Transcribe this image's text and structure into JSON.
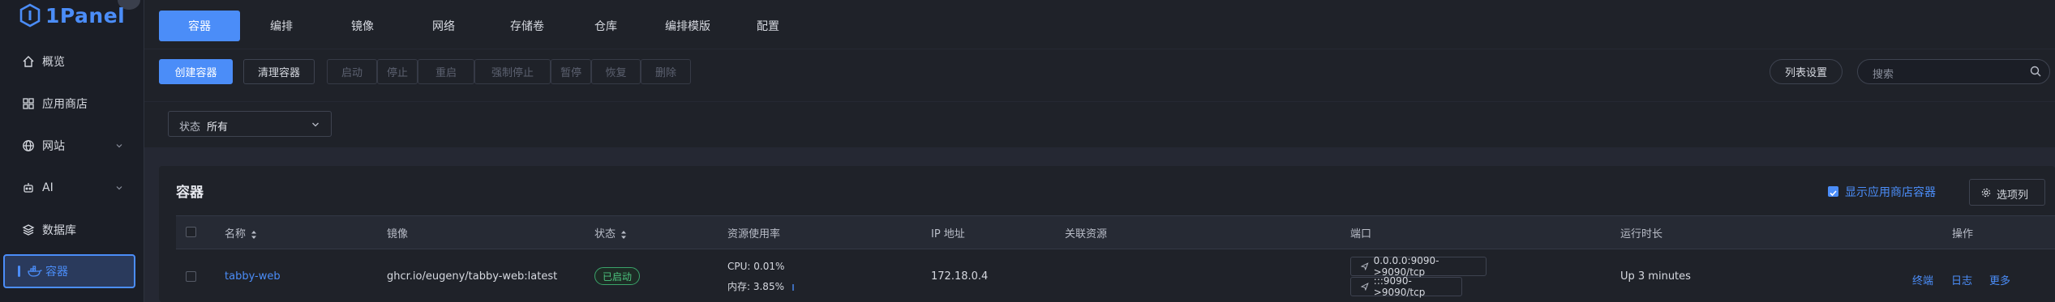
{
  "app": {
    "logo_text": "1Panel"
  },
  "sidebar": {
    "items": [
      {
        "label": "概览",
        "icon": "home-icon"
      },
      {
        "label": "应用商店",
        "icon": "grid-icon"
      },
      {
        "label": "网站",
        "icon": "globe-icon"
      },
      {
        "label": "AI",
        "icon": "robot-icon"
      },
      {
        "label": "数据库",
        "icon": "layers-icon"
      },
      {
        "label": "容器",
        "icon": "docker-icon"
      }
    ]
  },
  "tabs": [
    "容器",
    "编排",
    "镜像",
    "网络",
    "存储卷",
    "仓库",
    "编排模版",
    "配置"
  ],
  "toolbar": {
    "create_label": "创建容器",
    "clean_label": "清理容器",
    "actions": [
      "启动",
      "停止",
      "重启",
      "强制停止",
      "暂停",
      "恢复",
      "删除"
    ],
    "list_settings_label": "列表设置",
    "search_placeholder": "搜索"
  },
  "filter": {
    "status_label": "状态",
    "status_value": "所有"
  },
  "panel": {
    "title": "容器",
    "show_app_store_label": "显示应用商店容器",
    "columns_label": "选项列"
  },
  "table": {
    "headers": {
      "name": "名称",
      "image": "镜像",
      "status": "状态",
      "resources": "资源使用率",
      "ip": "IP 地址",
      "related": "关联资源",
      "ports": "端口",
      "uptime": "运行时长",
      "actions": "操作"
    },
    "rows": [
      {
        "name": "tabby-web",
        "image": "ghcr.io/eugeny/tabby-web:latest",
        "status": "已启动",
        "cpu": "CPU: 0.01%",
        "mem": "内存: 3.85%",
        "ip": "172.18.0.4",
        "ports": [
          "0.0.0.0:9090->9090/tcp",
          ":::9090->9090/tcp"
        ],
        "uptime": "Up 3 minutes",
        "actions": [
          "终端",
          "日志",
          "更多"
        ]
      }
    ]
  },
  "colors": {
    "accent": "#4b8df8",
    "success": "#4cc37e",
    "background": "#252833"
  }
}
